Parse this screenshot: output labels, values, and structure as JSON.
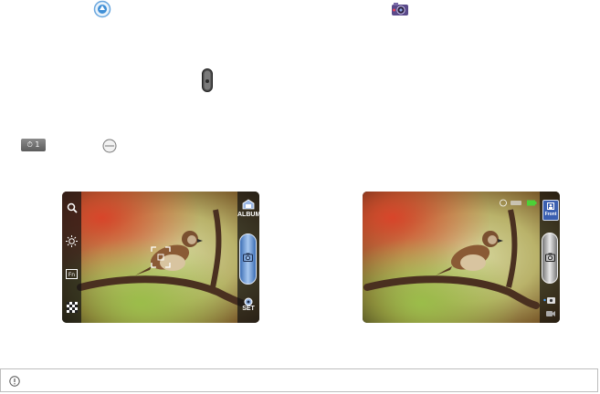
{
  "icons": {
    "tap": "camera-switch-icon",
    "camera": "camera-app-icon",
    "toggle": "mode-toggle-icon",
    "timer": "self-timer-icon",
    "zoom": "zoom-circle-icon",
    "note": "info-icon"
  },
  "screen_left": {
    "left_buttons": [
      "zoom-icon",
      "brightness-icon",
      "focus-mode-icon",
      "quality-icon"
    ],
    "album_label": "ALBUM",
    "set_label": "SET"
  },
  "screen_right": {
    "top_button_label": "Front"
  },
  "colors": {
    "shutter_blue": "#3d6fb6",
    "accent_battery": "#4cd137",
    "front_button": "#3a5fb0"
  }
}
